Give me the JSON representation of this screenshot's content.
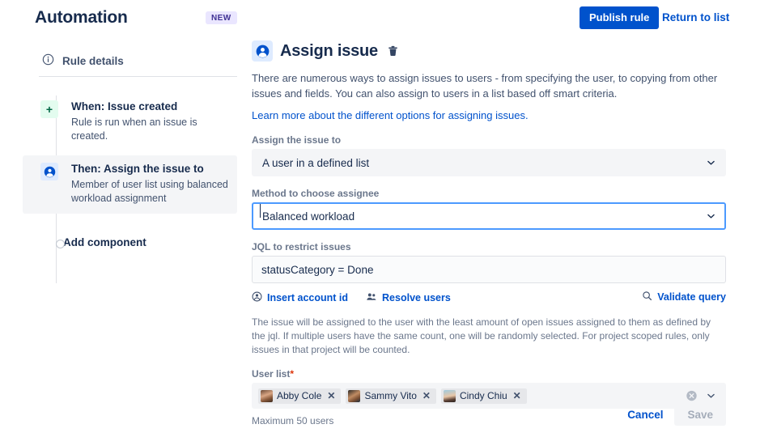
{
  "header": {
    "app_title": "Automation",
    "new_badge": "NEW",
    "publish_label": "Publish rule",
    "return_label": "Return to list"
  },
  "sidebar": {
    "rule_details_label": "Rule details",
    "steps": [
      {
        "badge": "+",
        "badge_icon": "plus-icon",
        "title": "When: Issue created",
        "subtitle": "Rule is run when an issue is created.",
        "active": false
      },
      {
        "badge": "",
        "badge_icon": "person-icon",
        "title": "Then: Assign the issue to",
        "subtitle": "Member of user list using balanced workload assignment",
        "active": true
      }
    ],
    "add_component_label": "Add component"
  },
  "main": {
    "panel_icon": "person-icon",
    "title": "Assign issue",
    "delete_icon": "trash-icon",
    "description": "There are numerous ways to assign issues to users - from specifying the user, to copying from other issues and fields. You can also assign to users in a list based off smart criteria.",
    "learn_more_link": "Learn more about the different options for assigning issues.",
    "assign_to": {
      "label": "Assign the issue to",
      "value": "A user in a defined list",
      "options": [
        "A user in a defined list"
      ]
    },
    "method": {
      "label": "Method to choose assignee",
      "value": "Balanced workload",
      "options": [
        "Balanced workload"
      ]
    },
    "jql": {
      "label": "JQL to restrict issues",
      "value": "statusCategory = Done",
      "placeholder": ""
    },
    "jql_actions": {
      "insert_account_id": "Insert account id",
      "insert_account_id_icon": "account-circle-icon",
      "resolve_users": "Resolve users",
      "resolve_users_icon": "people-icon",
      "validate_query": "Validate query",
      "validate_query_icon": "search-icon"
    },
    "hint": "The issue will be assigned to the user with the least amount of open issues assigned to them as defined by the jql. If multiple users have the same count, one will be randomly selected. For project scoped rules, only issues in that project will be counted.",
    "user_list": {
      "label": "User list",
      "required_marker": "*",
      "chips": [
        {
          "name": "Abby Cole",
          "remove_icon": "close-icon"
        },
        {
          "name": "Sammy Vito",
          "remove_icon": "close-icon"
        },
        {
          "name": "Cindy Chiu",
          "remove_icon": "close-icon"
        }
      ],
      "clear_icon": "clear-circle-icon",
      "expand_icon": "chevron-down-icon",
      "max_note": "Maximum 50 users"
    }
  },
  "footer": {
    "cancel_label": "Cancel",
    "save_label": "Save",
    "save_disabled": true
  },
  "colors": {
    "brand_blue": "#0052CC",
    "focus_blue": "#4C9AFF",
    "field_bg": "#F4F5F7",
    "text_dark": "#172B4D",
    "text_subtle": "#6B778C",
    "badge_purple_bg": "#EAE6FF",
    "badge_purple_text": "#403294",
    "badge_green_bg": "#E3FCEF",
    "badge_blue_bg": "#DEEBFF",
    "required_red": "#DE350B"
  }
}
